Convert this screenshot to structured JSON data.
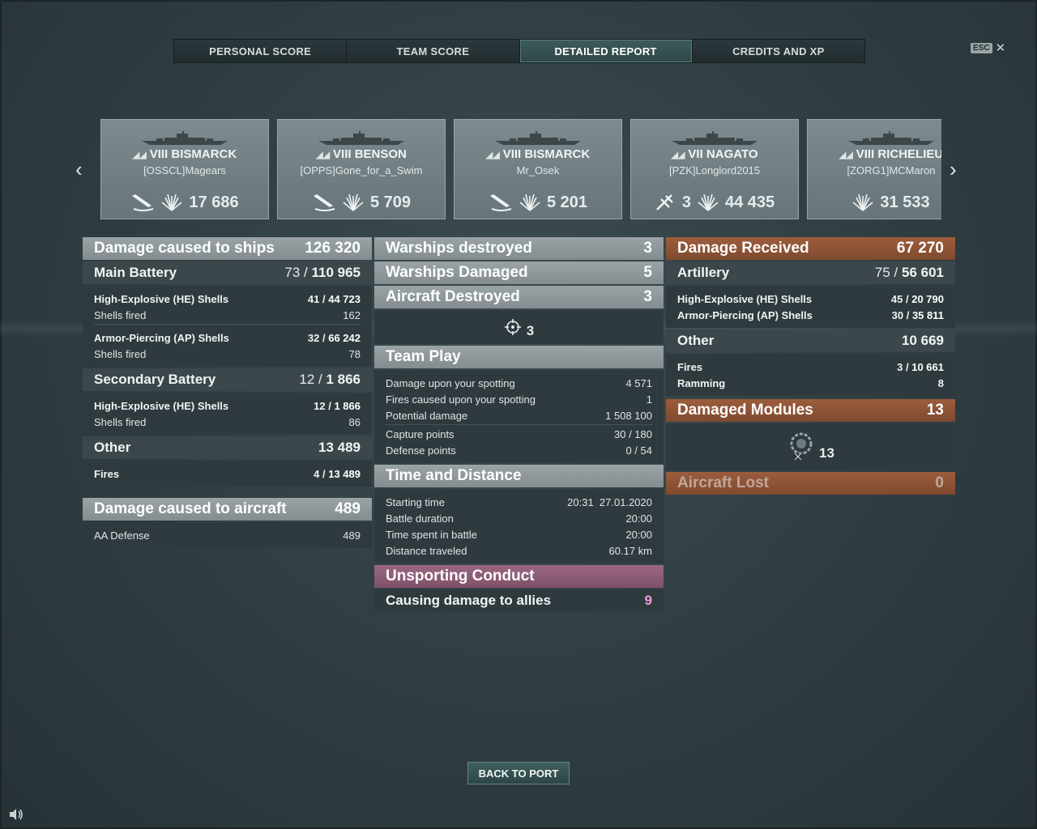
{
  "tabs": [
    "PERSONAL SCORE",
    "TEAM SCORE",
    "DETAILED REPORT",
    "CREDITS AND XP"
  ],
  "active_tab": "DETAILED REPORT",
  "esc_label": "ESC",
  "close_icon": "close-icon",
  "ships": [
    {
      "tier": "VIII",
      "name": "BISMARCK",
      "player": "[OSSCL]Magears",
      "icons": [
        "torpedo-hit-icon",
        "fire-damage-icon"
      ],
      "plane_count": "",
      "damage": "17 686"
    },
    {
      "tier": "VIII",
      "name": "BENSON",
      "player": "[OPPS]Gone_for_a_Swim",
      "icons": [
        "torpedo-hit-icon",
        "fire-damage-icon"
      ],
      "plane_count": "",
      "damage": "5 709"
    },
    {
      "tier": "VIII",
      "name": "BISMARCK",
      "player": "Mr_Osek",
      "icons": [
        "torpedo-hit-icon",
        "fire-damage-icon"
      ],
      "plane_count": "",
      "damage": "5 201"
    },
    {
      "tier": "VII",
      "name": "NAGATO",
      "player": "[PZK]Longlord2015",
      "icons": [
        "plane-shot-icon",
        "fire-damage-icon"
      ],
      "plane_count": "3",
      "damage": "44 435"
    },
    {
      "tier": "VIII",
      "name": "RICHELIEU",
      "player": "[ZORG1]MCMaron",
      "icons": [
        "fire-damage-icon"
      ],
      "plane_count": "",
      "damage": "31 533"
    }
  ],
  "left": {
    "damage_ships_label": "Damage caused to ships",
    "damage_ships_value": "126 320",
    "main_battery_label": "Main Battery",
    "main_battery_hits": "73",
    "main_battery_damage": "110 965",
    "he_label": "High-Explosive (HE) Shells",
    "he_hits": "41",
    "he_damage": "44 723",
    "he_fired_label": "Shells fired",
    "he_fired": "162",
    "ap_label": "Armor-Piercing (AP) Shells",
    "ap_hits": "32",
    "ap_damage": "66 242",
    "ap_fired_label": "Shells fired",
    "ap_fired": "78",
    "secondary_label": "Secondary Battery",
    "secondary_hits": "12",
    "secondary_damage": "1 866",
    "sec_he_label": "High-Explosive (HE) Shells",
    "sec_he_hits": "12",
    "sec_he_damage": "1 866",
    "sec_fired_label": "Shells fired",
    "sec_fired": "86",
    "other_label": "Other",
    "other_value": "13 489",
    "fires_label": "Fires",
    "fires_hits": "4",
    "fires_damage": "13 489",
    "aircraft_label": "Damage caused to aircraft",
    "aircraft_value": "489",
    "aa_label": "AA Defense",
    "aa_value": "489"
  },
  "middle": {
    "warships_destroyed_label": "Warships destroyed",
    "warships_destroyed": "3",
    "warships_damaged_label": "Warships Damaged",
    "warships_damaged": "5",
    "aircraft_destroyed_label": "Aircraft Destroyed",
    "aircraft_destroyed": "3",
    "kills_count": "3",
    "team_play_label": "Team Play",
    "spotting_damage_label": "Damage upon your spotting",
    "spotting_damage": "4 571",
    "spotting_fires_label": "Fires caused upon your spotting",
    "spotting_fires": "1",
    "potential_label": "Potential damage",
    "potential": "1 508 100",
    "capture_label": "Capture points",
    "capture": "30 / 180",
    "defense_label": "Defense points",
    "defense": "0 / 54",
    "time_label": "Time and Distance",
    "start_label": "Starting time",
    "start_time": "20:31",
    "start_date": "27.01.2020",
    "duration_label": "Battle duration",
    "duration": "20:00",
    "time_in_battle_label": "Time spent in battle",
    "time_in_battle": "20:00",
    "distance_label": "Distance traveled",
    "distance": "60.17 km",
    "unsporting_label": "Unsporting Conduct",
    "allies_damage_label": "Causing damage to allies",
    "allies_damage": "9"
  },
  "right": {
    "received_label": "Damage Received",
    "received_value": "67 270",
    "artillery_label": "Artillery",
    "artillery_hits": "75",
    "artillery_damage": "56 601",
    "he_label": "High-Explosive (HE) Shells",
    "he_hits": "45",
    "he_damage": "20 790",
    "ap_label": "Armor-Piercing (AP) Shells",
    "ap_hits": "30",
    "ap_damage": "35 811",
    "other_label": "Other",
    "other_value": "10 669",
    "fires_label": "Fires",
    "fires_hits": "3",
    "fires_damage": "10 661",
    "ramming_label": "Ramming",
    "ramming": "8",
    "modules_label": "Damaged Modules",
    "modules_value": "13",
    "modules_count": "13",
    "aircraft_lost_label": "Aircraft Lost",
    "aircraft_lost": "0"
  },
  "back_label": "BACK TO PORT",
  "colors": {
    "accent_active_tab": "#3e5c5b",
    "damage_received": "#9c5d3c",
    "unsporting": "#9a6782",
    "allies_value": "#f49ad8"
  }
}
